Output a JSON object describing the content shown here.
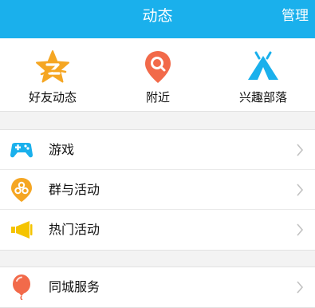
{
  "header": {
    "title": "动态",
    "manage_label": "管理",
    "background_color": "#1ab0ec"
  },
  "quick_entries": [
    {
      "label": "好友动态",
      "icon": "qzone-star-icon",
      "color": "#f5a623"
    },
    {
      "label": "附近",
      "icon": "location-pin-icon",
      "color": "#f26a4a"
    },
    {
      "label": "兴趣部落",
      "icon": "tent-icon",
      "color": "#1ab0ec"
    }
  ],
  "groups": [
    {
      "items": [
        {
          "label": "游戏",
          "icon": "gamepad-icon",
          "color": "#1ab0ec"
        },
        {
          "label": "群与活动",
          "icon": "group-activity-icon",
          "color": "#f5a623"
        },
        {
          "label": "热门活动",
          "icon": "megaphone-icon",
          "color": "#f5c400"
        }
      ]
    },
    {
      "items": [
        {
          "label": "同城服务",
          "icon": "balloon-icon",
          "color": "#f26a4a"
        }
      ]
    }
  ]
}
